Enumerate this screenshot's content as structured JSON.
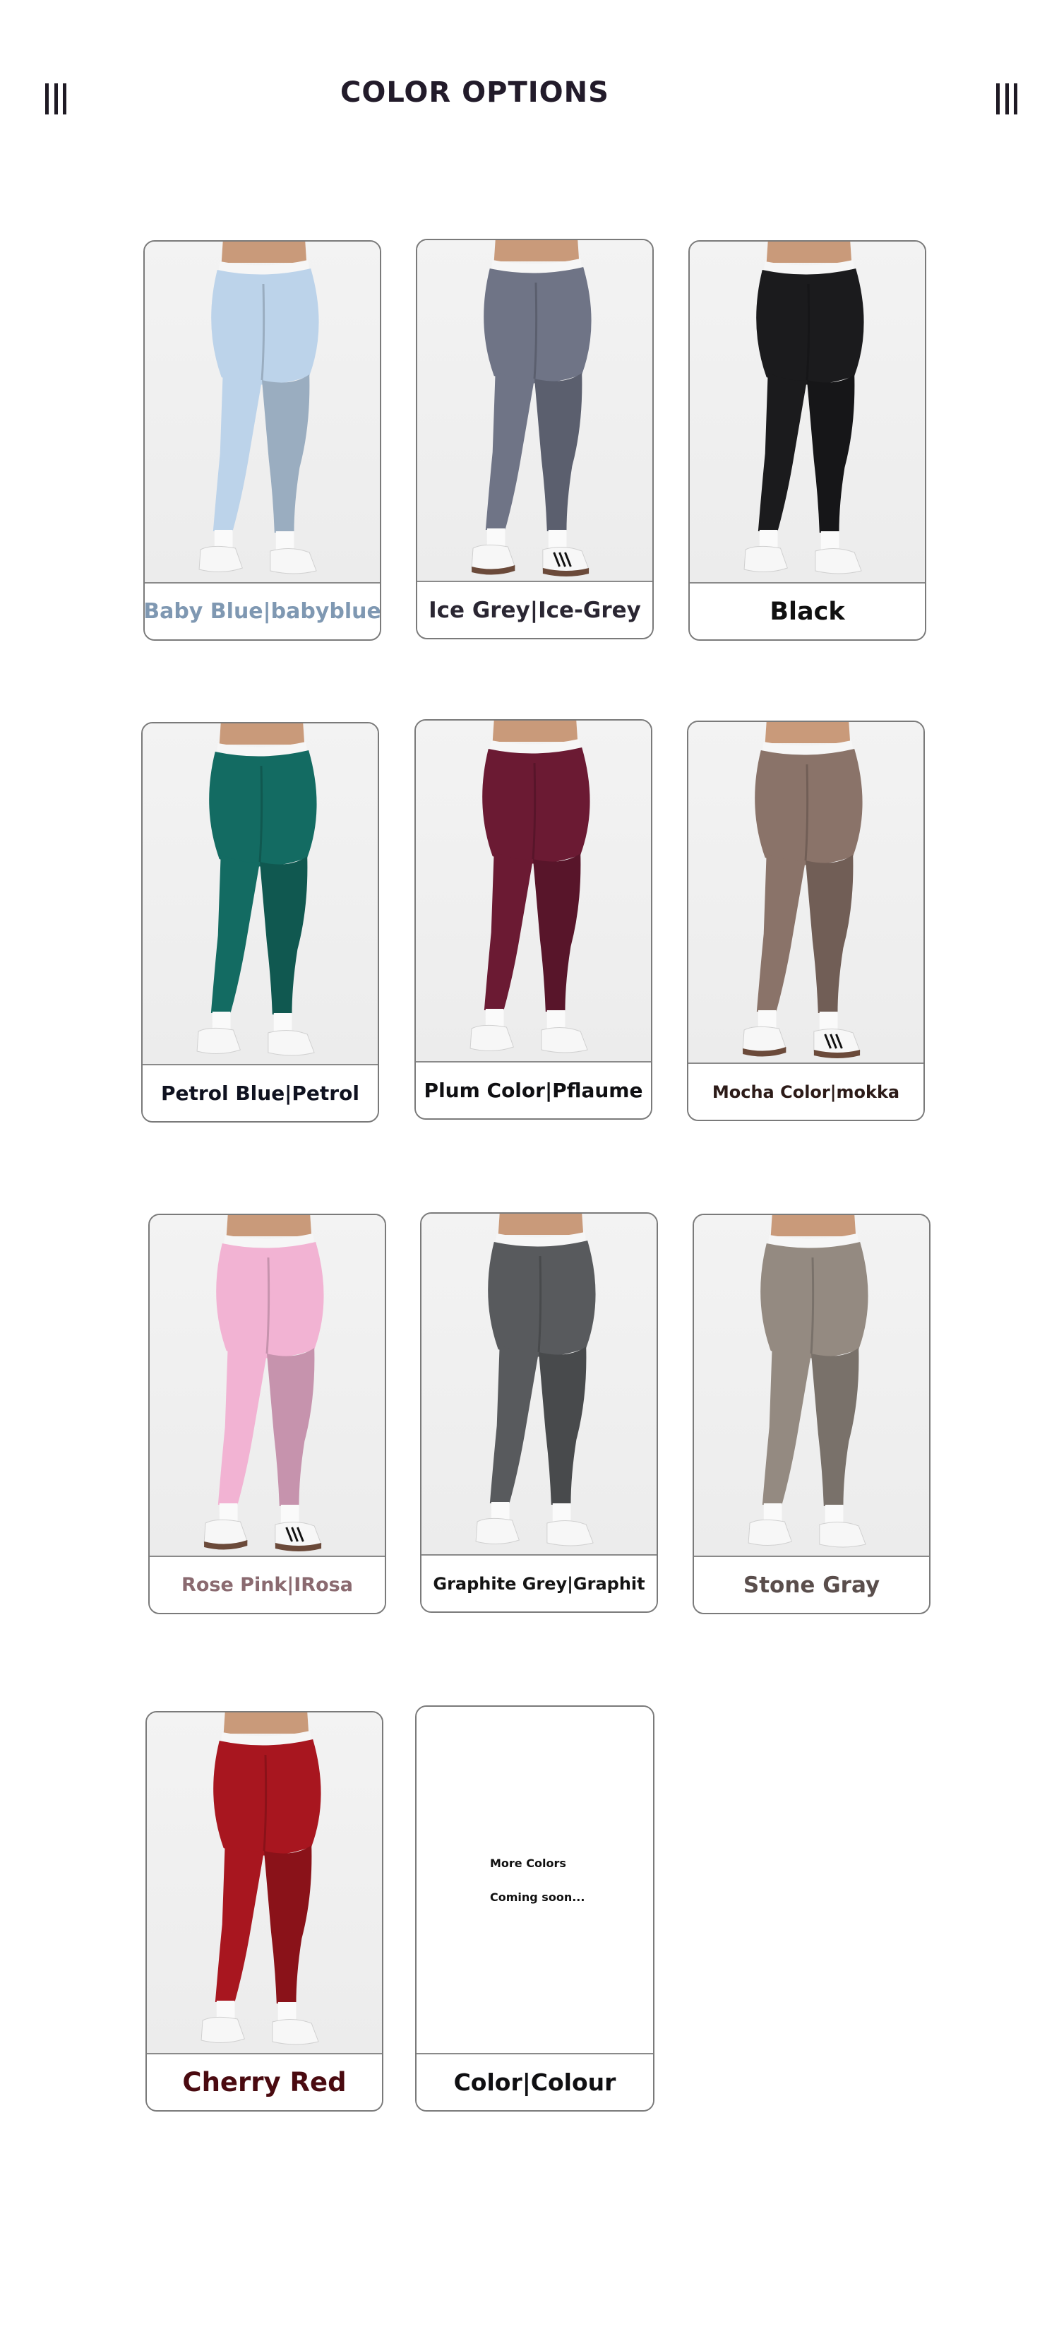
{
  "header": {
    "title": "COLOR OPTIONS",
    "left_icon": "menu-bars-icon",
    "right_icon": "menu-bars-icon"
  },
  "products": [
    {
      "label": "Baby Blue|babyblue",
      "legging_color": "#bcd3ea",
      "label_color": "#7f98b2",
      "label_size": "30px",
      "shoe": "white"
    },
    {
      "label": "Ice Grey|Ice-Grey",
      "legging_color": "#6f7486",
      "label_color": "#2a2632",
      "label_size": "31px",
      "shoe": "samba"
    },
    {
      "label": "Black",
      "legging_color": "#1b1b1d",
      "label_color": "#101010",
      "label_size": "35px",
      "shoe": "white"
    },
    {
      "label": "Petrol Blue|Petrol",
      "legging_color": "#136b62",
      "label_color": "#0f1220",
      "label_size": "28px",
      "shoe": "white"
    },
    {
      "label": "Plum Color|Pflaume",
      "legging_color": "#6b1a33",
      "label_color": "#0f0f12",
      "label_size": "28px",
      "shoe": "white"
    },
    {
      "label": "Mocha Color|mokka",
      "legging_color": "#8a7369",
      "label_color": "#2c1b18",
      "label_size": "24px",
      "shoe": "samba"
    },
    {
      "label": "Rose Pink|IRosa",
      "legging_color": "#f2b3d3",
      "label_color": "#8a6a70",
      "label_size": "27px",
      "shoe": "samba"
    },
    {
      "label": "Graphite Grey|Graphit",
      "legging_color": "#585a5d",
      "label_color": "#141414",
      "label_size": "24px",
      "shoe": "white"
    },
    {
      "label": "Stone Gray",
      "legging_color": "#948a81",
      "label_color": "#5a4e4c",
      "label_size": "31px",
      "shoe": "white"
    },
    {
      "label": "Cherry Red",
      "legging_color": "#a8161f",
      "label_color": "#4a0a10",
      "label_size": "37px",
      "shoe": "white"
    }
  ],
  "coming_soon": {
    "line1": "More Colors",
    "line2": "Coming soon...",
    "label": "Color|Colour",
    "label_color": "#0f0f12",
    "label_size": "33px"
  }
}
